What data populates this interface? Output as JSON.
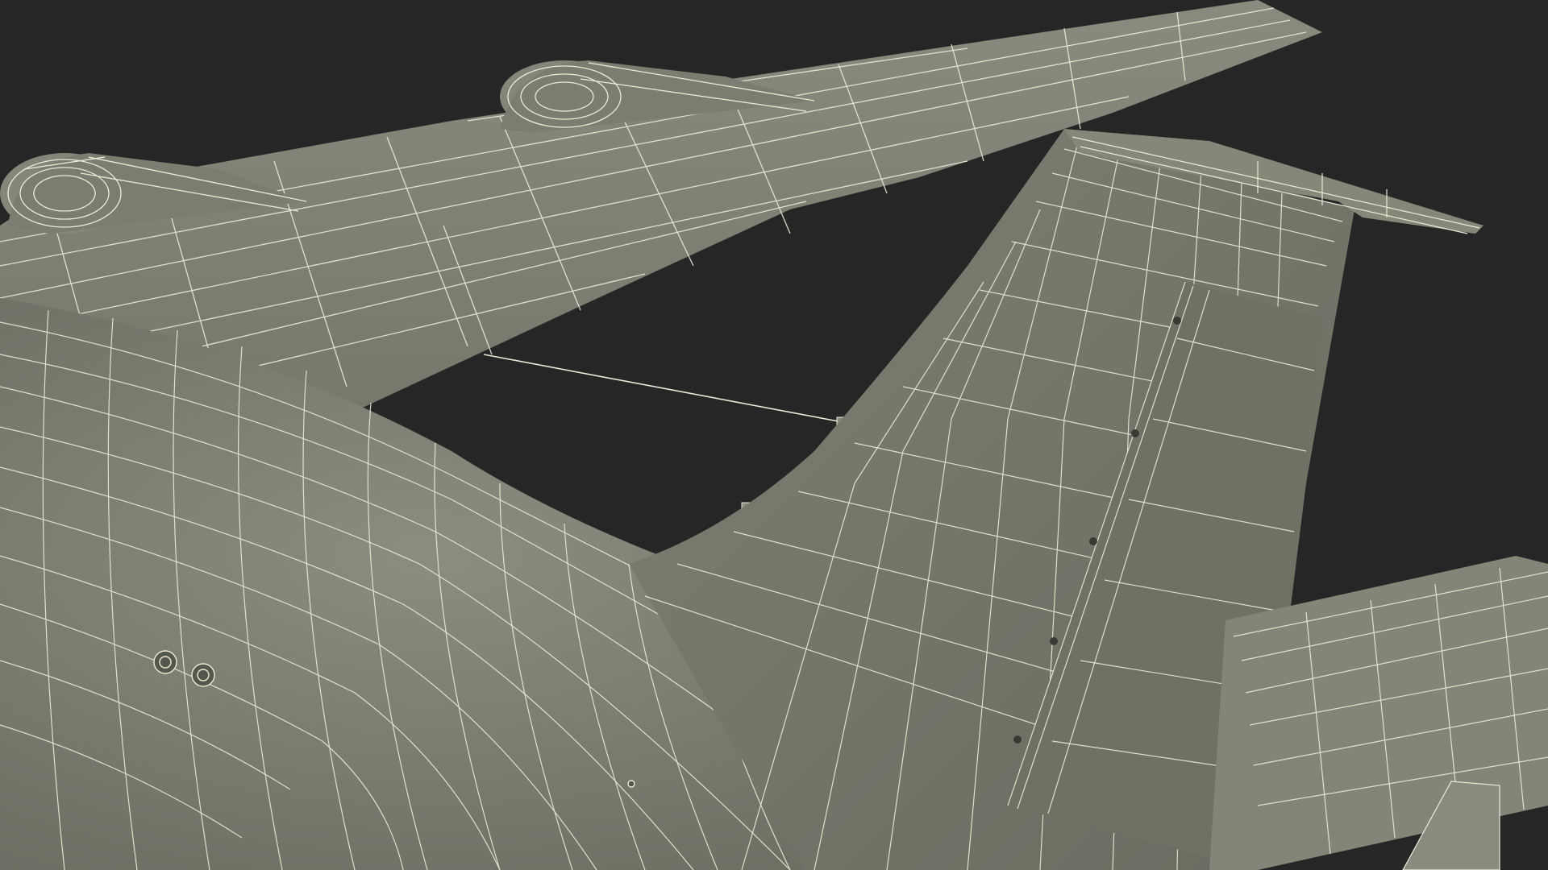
{
  "scene": {
    "subject": "wireframe-aircraft-tail-section",
    "colors": {
      "background": "#262626",
      "surface": "#7d7e71",
      "surface_shadow": "#6c6d61",
      "surface_light": "#8b8c7f",
      "wire": "#ecebd9"
    },
    "parts": [
      {
        "id": "main-wing",
        "label": ""
      },
      {
        "id": "engine-nacelle-left",
        "label": ""
      },
      {
        "id": "engine-nacelle-right",
        "label": ""
      },
      {
        "id": "fuselage",
        "label": ""
      },
      {
        "id": "vertical-stabilizer",
        "label": ""
      },
      {
        "id": "rudder",
        "label": ""
      },
      {
        "id": "horizontal-stabilizer-right",
        "label": ""
      },
      {
        "id": "horizontal-stabilizer-left",
        "label": ""
      },
      {
        "id": "antenna-wire",
        "label": ""
      }
    ]
  }
}
